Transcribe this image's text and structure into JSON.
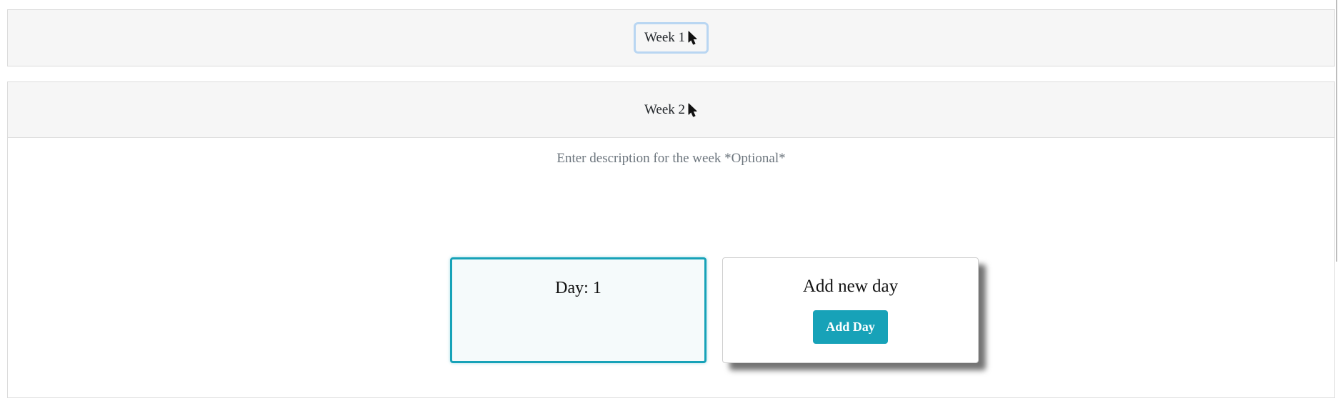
{
  "weeks": [
    {
      "label": "Week 1"
    },
    {
      "label": "Week 2",
      "description_placeholder": "Enter description for the week *Optional*",
      "days": [
        {
          "label": "Day: 1"
        }
      ],
      "add_card": {
        "title": "Add new day",
        "button_label": "Add Day"
      }
    }
  ],
  "colors": {
    "accent": "#17a2b8",
    "header_bg": "#f6f6f6",
    "focus_ring": "#b9d6f2",
    "muted_text": "#6c757d"
  },
  "icons": {
    "week_toggle_cursor": "cursor-arrow-icon"
  }
}
